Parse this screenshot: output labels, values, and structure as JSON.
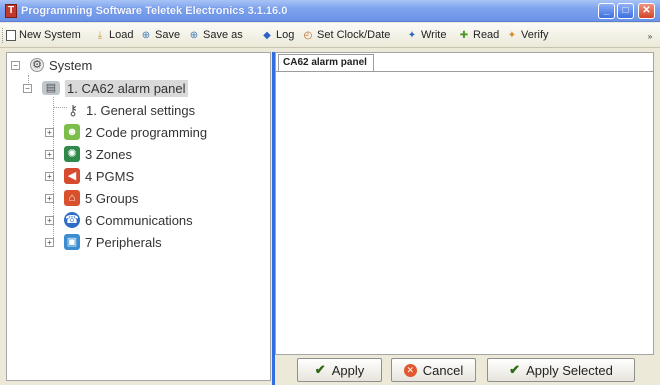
{
  "window": {
    "title": "Programming Software Teletek Electronics  3.1.16.0",
    "minimize": "_",
    "maximize": "□",
    "close": "✕"
  },
  "toolbar": {
    "items": [
      {
        "label": "New System",
        "icon": "new-system-icon",
        "glyph": "□"
      },
      {
        "label": "Load",
        "icon": "load-icon",
        "glyph": "⤓"
      },
      {
        "label": "Save",
        "icon": "save-icon",
        "glyph": "⊕"
      },
      {
        "label": "Save as",
        "icon": "save-as-icon",
        "glyph": "⊕"
      },
      {
        "label": "Log",
        "icon": "log-icon",
        "glyph": "◆"
      },
      {
        "label": "Set Clock/Date",
        "icon": "clock-icon",
        "glyph": "◴"
      },
      {
        "label": "Write",
        "icon": "write-icon",
        "glyph": "✦"
      },
      {
        "label": "Read",
        "icon": "read-icon",
        "glyph": "✚"
      },
      {
        "label": "Verify",
        "icon": "verify-icon",
        "glyph": "✦"
      }
    ],
    "overflow": "»"
  },
  "tree": {
    "root": {
      "label": "System",
      "expander": "−"
    },
    "panel": {
      "label": "1. CA62 alarm panel",
      "expander": "−"
    },
    "children": [
      {
        "label": "1. General settings",
        "expander": "",
        "icon": "key-icon",
        "glyph": "⚷",
        "color": "#e9e9e9"
      },
      {
        "label": "2 Code programming",
        "expander": "+",
        "icon": "users-icon",
        "glyph": "☻",
        "color": "#7bbf4a"
      },
      {
        "label": "3 Zones",
        "expander": "+",
        "icon": "zones-icon",
        "glyph": "✺",
        "color": "#2f8a4a"
      },
      {
        "label": "4 PGMS",
        "expander": "+",
        "icon": "pgms-icon",
        "glyph": "◀",
        "color": "#d64a2d"
      },
      {
        "label": "5 Groups",
        "expander": "+",
        "icon": "groups-icon",
        "glyph": "⌂",
        "color": "#d8502c"
      },
      {
        "label": "6 Communications",
        "expander": "+",
        "icon": "communications-icon",
        "glyph": "☎",
        "color": "#2d6fc4"
      },
      {
        "label": "7 Peripherals",
        "expander": "+",
        "icon": "peripherals-icon",
        "glyph": "▣",
        "color": "#3c8cd0"
      }
    ]
  },
  "tab": {
    "label": "CA62 alarm panel"
  },
  "buttons": {
    "apply": "Apply",
    "cancel": "Cancel",
    "apply_selected": "Apply Selected"
  }
}
